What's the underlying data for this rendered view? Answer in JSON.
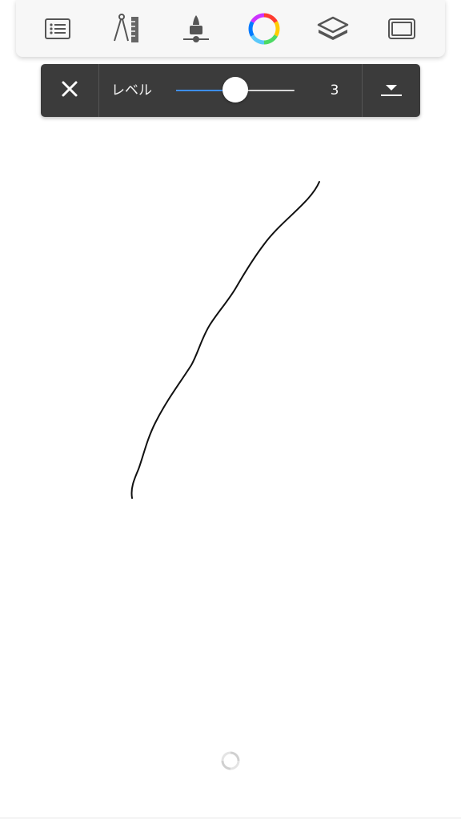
{
  "toolbar": {
    "icons": [
      "list-icon",
      "compass-ruler-icon",
      "brush-icon",
      "color-wheel-icon",
      "layers-icon",
      "canvas-frame-icon"
    ]
  },
  "level_panel": {
    "label": "レベル",
    "value": "3",
    "slider_fraction": 0.5,
    "accent_color": "#3d8ef0"
  },
  "canvas": {
    "stroke_color": "#111111"
  }
}
